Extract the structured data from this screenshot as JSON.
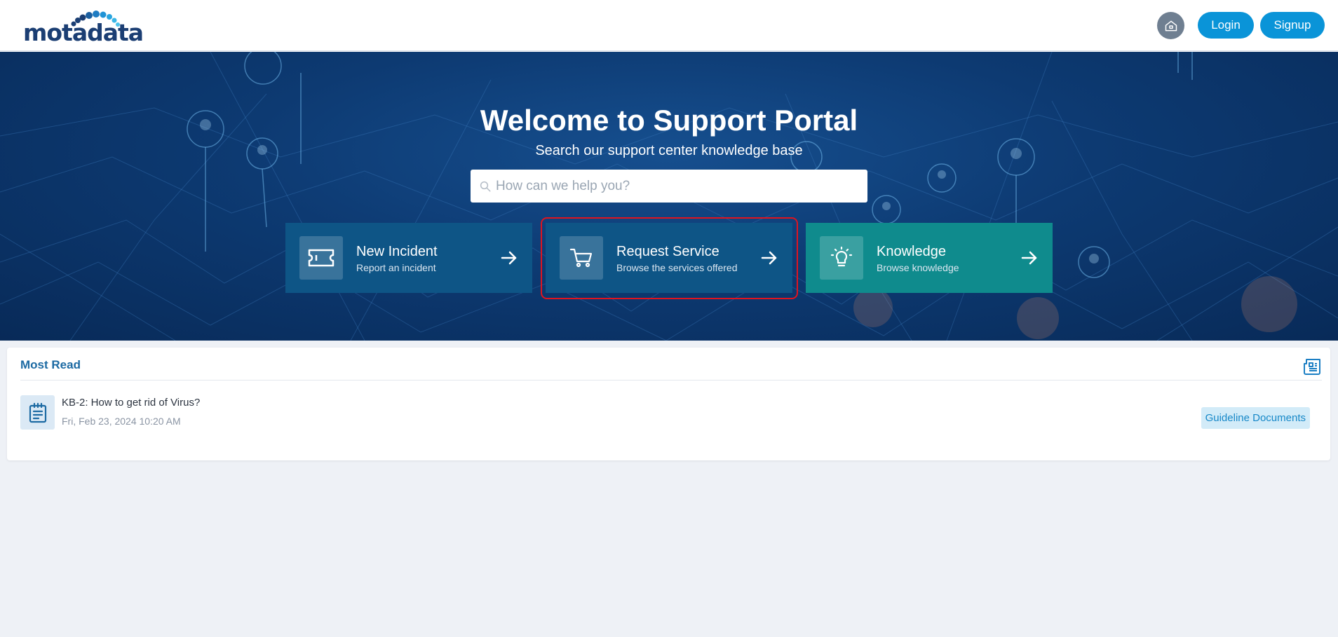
{
  "header": {
    "logo_text": "motadata",
    "home_icon": "home-icon",
    "login_label": "Login",
    "signup_label": "Signup"
  },
  "hero": {
    "title": "Welcome to Support Portal",
    "subtitle": "Search our support center knowledge base",
    "search": {
      "placeholder": "How can we help you?",
      "value": ""
    },
    "cards": [
      {
        "title": "New Incident",
        "subtitle": "Report an incident",
        "icon": "ticket-icon"
      },
      {
        "title": "Request Service",
        "subtitle": "Browse the services offered",
        "icon": "cart-icon"
      },
      {
        "title": "Knowledge",
        "subtitle": "Browse knowledge",
        "icon": "lightbulb-icon"
      }
    ]
  },
  "most_read": {
    "title": "Most Read",
    "panel_icon": "newspaper-icon",
    "items": [
      {
        "title": "KB-2: How to get rid of Virus?",
        "date": "Fri, Feb 23, 2024 10:20 AM",
        "category": "Guideline Documents",
        "icon": "document-list-icon"
      }
    ]
  },
  "colors": {
    "brand_blue": "#0a94d8",
    "logo_navy": "#1b3e73",
    "card_blue": "#0e5586",
    "card_teal": "#0f8b8d",
    "highlight_red": "#e0141f",
    "link_blue": "#1c6aa3"
  }
}
